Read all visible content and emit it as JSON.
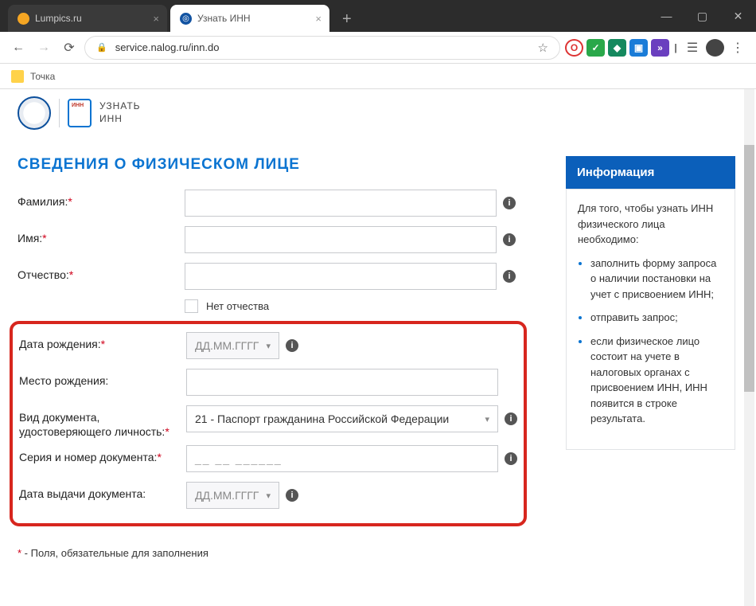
{
  "browser": {
    "tabs": [
      {
        "title": "Lumpics.ru",
        "active": false,
        "favicon_bg": "#f5a623"
      },
      {
        "title": "Узнать ИНН",
        "active": true,
        "favicon_bg": "#1253a2"
      }
    ],
    "url": "service.nalog.ru/inn.do",
    "bookmark": "Точка"
  },
  "brand": {
    "line1": "УЗНАТЬ",
    "line2": "ИНН"
  },
  "heading": "Сведения о физическом лице",
  "fields": {
    "surname": {
      "label": "Фамилия:"
    },
    "name": {
      "label": "Имя:"
    },
    "patronymic": {
      "label": "Отчество:"
    },
    "no_patronymic": "Нет отчества",
    "dob": {
      "label": "Дата рождения:",
      "placeholder": "ДД.ММ.ГГГГ"
    },
    "pob": {
      "label": "Место рождения:"
    },
    "doctype": {
      "label": "Вид документа, удостоверяющего личность:",
      "value": "21 - Паспорт гражданина Российской Федерации"
    },
    "docnum": {
      "label": "Серия и номер документа:",
      "mask": "__ __ ______"
    },
    "docdate": {
      "label": "Дата выдачи документа:",
      "placeholder": "ДД.ММ.ГГГГ"
    }
  },
  "footnote_prefix": "*",
  "footnote": " - Поля, обязательные для заполнения",
  "info_panel": {
    "title": "Информация",
    "lead": "Для того, чтобы узнать ИНН физического лица необходимо:",
    "items": [
      "заполнить форму запроса о наличии постановки на учет с присвоением ИНН;",
      "отправить запрос;",
      "если физическое лицо состоит на учете в налоговых органах с присвоением ИНН, ИНН появится в строке результата."
    ]
  }
}
